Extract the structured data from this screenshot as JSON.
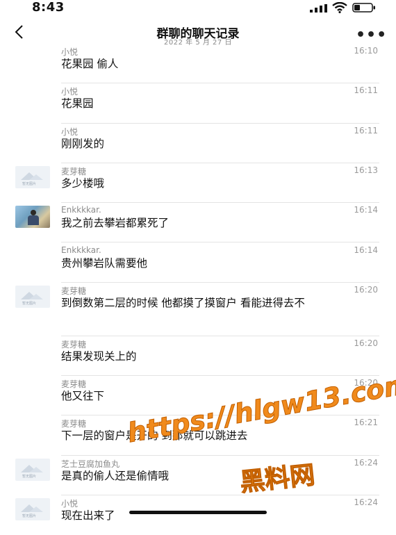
{
  "status": {
    "time": "8:43"
  },
  "nav": {
    "title": "群聊的聊天记录",
    "subtitle": "2022 年 5 月 27 日"
  },
  "messages": [
    {
      "name": "小悦",
      "time": "16:10",
      "text": "花果园 偷人",
      "avatar": "none"
    },
    {
      "name": "小悦",
      "time": "16:11",
      "text": "花果园",
      "avatar": "none"
    },
    {
      "name": "小悦",
      "time": "16:11",
      "text": "刚刚发的",
      "avatar": "none"
    },
    {
      "name": "麦芽糖",
      "time": "16:13",
      "text": "多少楼哦",
      "avatar": "placeholder"
    },
    {
      "name": "Enkkkkar.",
      "time": "16:14",
      "text": "我之前去攀岩都累死了",
      "avatar": "photo"
    },
    {
      "name": "Enkkkkar.",
      "time": "16:14",
      "text": "贵州攀岩队需要他",
      "avatar": "none"
    },
    {
      "name": "麦芽糖",
      "time": "16:20",
      "text": "到倒数第二层的时候 他都摸了摸窗户 看能进得去不",
      "avatar": "placeholder"
    },
    {
      "name": "麦芽糖",
      "time": "16:20",
      "text": "结果发现关上的",
      "avatar": "none"
    },
    {
      "name": "麦芽糖",
      "time": "16:20",
      "text": "他又往下",
      "avatar": "none"
    },
    {
      "name": "麦芽糖",
      "time": "16:21",
      "text": "下一层的窗户是开的 到那就可以跳进去",
      "avatar": "none"
    },
    {
      "name": "芝士豆腐加鱼丸",
      "time": "16:24",
      "text": "是真的偷人还是偷情哦",
      "avatar": "placeholder"
    },
    {
      "name": "小悦",
      "time": "16:24",
      "text": "现在出来了",
      "avatar": "placeholder"
    }
  ],
  "placeholder_avatar_caption": "暂无图片",
  "watermark": {
    "url": "https://hlgw13.com",
    "name": "黑料网"
  },
  "colors": {
    "name": "#8b8b8b",
    "time": "#9a9a9a",
    "divider": "#e4e4e4",
    "watermark": "#f08a1c"
  },
  "icons": {
    "back": "chevron-left-icon",
    "more": "more-dots-icon",
    "signal": "signal-icon",
    "wifi": "wifi-icon",
    "battery": "battery-icon"
  }
}
